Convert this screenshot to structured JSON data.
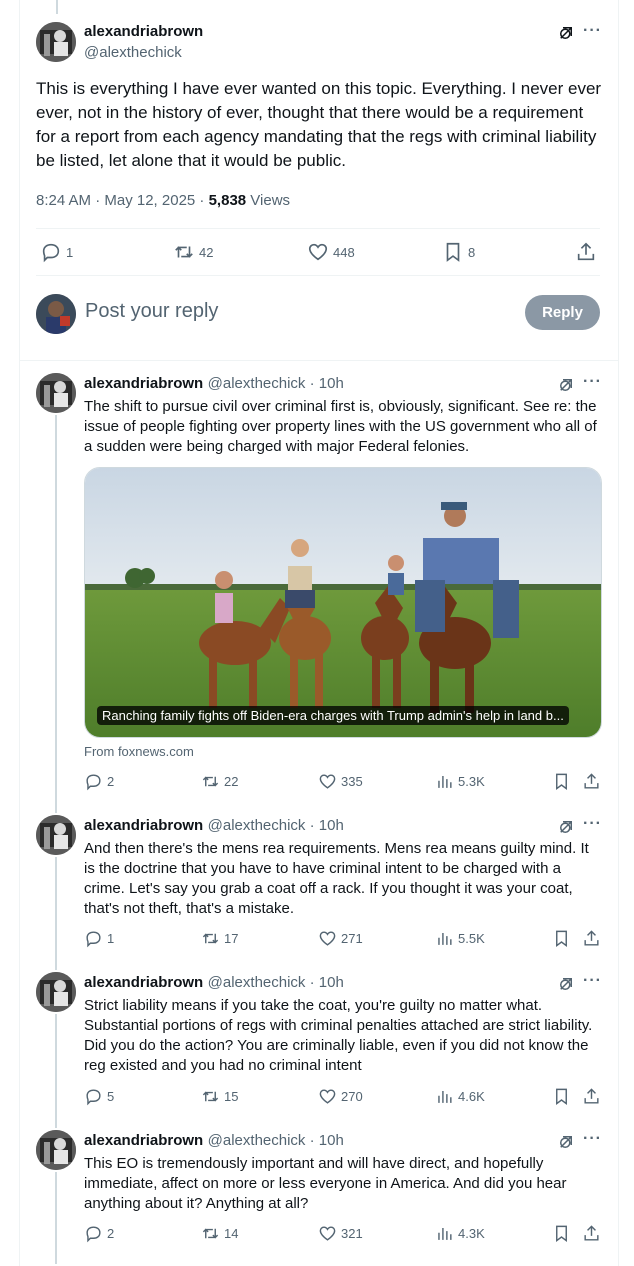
{
  "main_tweet": {
    "name": "alexandriabrown",
    "handle": "@alexthechick",
    "text": "This is everything I have ever wanted on this topic.  Everything.  I never ever ever, not in the history of ever, thought that there would be a requirement for a report from each agency mandating that the regs with criminal liability be listed, let alone that it would be public.",
    "time": "8:24 AM · May 12, 2025 · ",
    "views_count": "5,838",
    "views_label": " Views",
    "replies": "1",
    "retweets": "42",
    "likes": "448",
    "bookmarks": "8"
  },
  "reply_box": {
    "placeholder": "Post your reply",
    "button": "Reply"
  },
  "replies": [
    {
      "name": "alexandriabrown",
      "handle": "@alexthechick · 10h",
      "text": "The shift to pursue civil over criminal first is, obviously, significant.  See re: the issue of people fighting over property lines with the US government who all of a sudden were being charged with major Federal felonies.",
      "card_caption": "Ranching family fights off Biden-era charges with Trump admin's help in land b...",
      "card_source": "From foxnews.com",
      "replies": "2",
      "retweets": "22",
      "likes": "335",
      "views": "5.3K"
    },
    {
      "name": "alexandriabrown",
      "handle": "@alexthechick · 10h",
      "text": "And then there's the mens rea requirements.  Mens rea means guilty mind.  It is the doctrine that you have to have criminal intent to be charged with a crime.  Let's say you grab a coat off a rack.  If you thought it was your coat, that's not theft, that's a mistake.",
      "replies": "1",
      "retweets": "17",
      "likes": "271",
      "views": "5.5K"
    },
    {
      "name": "alexandriabrown",
      "handle": "@alexthechick · 10h",
      "text": "Strict liability means if you take the coat, you're guilty no matter what.  Substantial portions of regs with criminal penalties attached are strict liability. Did you do the action? You are criminally liable, even if you did not know the reg existed and you had no criminal intent",
      "replies": "5",
      "retweets": "15",
      "likes": "270",
      "views": "4.6K"
    },
    {
      "name": "alexandriabrown",
      "handle": "@alexthechick · 10h",
      "text": "This EO is tremendously important and will have direct, and hopefully immediate, affect on more or less everyone in America.  And did you hear anything about it?  Anything at all?",
      "replies": "2",
      "retweets": "14",
      "likes": "321",
      "views": "4.3K"
    }
  ],
  "colors": {
    "text": "#0f1419",
    "secondary": "#536471",
    "border": "#eff3f4",
    "reply_button": "#8b98a5"
  },
  "icons": [
    "reply-icon",
    "retweet-icon",
    "like-icon",
    "bookmark-icon",
    "share-icon",
    "views-icon",
    "grok-icon",
    "more-icon"
  ]
}
